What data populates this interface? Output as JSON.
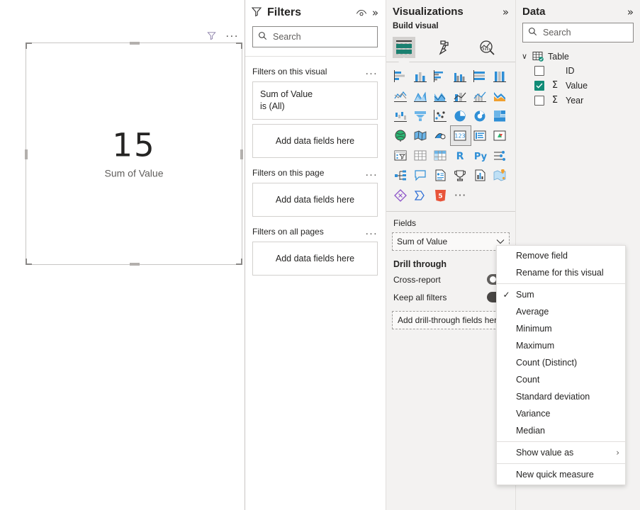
{
  "canvas": {
    "visual_header": {
      "filter_icon": "filter-icon",
      "more_options": "..."
    },
    "card_visual": {
      "value": "15",
      "label": "Sum of Value"
    }
  },
  "filters_pane": {
    "title": "Filters",
    "eye_icon": "eye-icon",
    "collapse_icon": "»",
    "search": {
      "placeholder": "Search",
      "value": "",
      "icon": "search-icon"
    },
    "sections": [
      {
        "title": "Filters on this visual",
        "more": "...",
        "card": {
          "line1": "Sum of Value",
          "line2": "is (All)"
        },
        "dropzone": "Add data fields here"
      },
      {
        "title": "Filters on this page",
        "more": "...",
        "dropzone": "Add data fields here"
      },
      {
        "title": "Filters on all pages",
        "more": "...",
        "dropzone": "Add data fields here"
      }
    ]
  },
  "visualizations_pane": {
    "title": "Visualizations",
    "collapse_icon": "»",
    "build_label": "Build visual",
    "build_tabs": [
      {
        "name": "build-visual-tab",
        "icon": "table-grid-icon",
        "active": true
      },
      {
        "name": "format-visual-tab",
        "icon": "paint-roller-icon",
        "active": false
      },
      {
        "name": "analytics-tab",
        "icon": "magnifier-chart-icon",
        "active": false
      }
    ],
    "viz_icons": [
      "stacked-bar-chart-icon",
      "stacked-column-chart-icon",
      "clustered-bar-chart-icon",
      "clustered-column-chart-icon",
      "100-stacked-bar-chart-icon",
      "100-stacked-column-chart-icon",
      "line-chart-icon",
      "area-chart-icon",
      "stacked-area-chart-icon",
      "line-and-stacked-column-chart-icon",
      "line-and-clustered-column-chart-icon",
      "ribbon-chart-icon",
      "waterfall-chart-icon",
      "funnel-icon",
      "scatter-chart-icon",
      "pie-chart-icon",
      "donut-chart-icon",
      "treemap-icon",
      "map-icon",
      "filled-map-icon",
      "azure-map-icon",
      "card-icon",
      "multi-row-card-icon",
      "kpi-icon",
      "slicer-icon",
      "table-icon",
      "matrix-icon",
      "r-script-visual-icon",
      "python-visual-icon",
      "key-influencers-icon",
      "decomposition-tree-icon",
      "qna-icon",
      "smart-narrative-icon",
      "paginated-report-icon",
      "power-apps-icon",
      "arcgis-maps-icon",
      "powerapps-diamond-icon",
      "power-automate-icon",
      "html5-icon",
      "more-visuals-icon"
    ],
    "selected_viz_index": 21,
    "fields_label": "Fields",
    "field_well": {
      "value": "Sum of Value",
      "chevron": "chevron-down-icon"
    },
    "drill_through": {
      "title": "Drill through",
      "rows": [
        {
          "label": "Cross-report",
          "state": "off"
        },
        {
          "label": "Keep all filters",
          "state": "on"
        }
      ],
      "dropzone": "Add drill-through fields here"
    }
  },
  "data_pane": {
    "title": "Data",
    "collapse_icon": "»",
    "search": {
      "placeholder": "Search",
      "value": "",
      "icon": "search-icon"
    },
    "tree": {
      "table_name": "Table",
      "expanded_chevron": "∨",
      "fields": [
        {
          "label": "ID",
          "checked": false,
          "is_measure": false
        },
        {
          "label": "Value",
          "checked": true,
          "is_measure": true
        },
        {
          "label": "Year",
          "checked": false,
          "is_measure": true
        }
      ]
    }
  },
  "context_menu": {
    "items": [
      {
        "label": "Remove field",
        "checked": false,
        "submenu": false
      },
      {
        "label": "Rename for this visual",
        "checked": false,
        "submenu": false
      },
      {
        "separator": true
      },
      {
        "label": "Sum",
        "checked": true,
        "submenu": false
      },
      {
        "label": "Average",
        "checked": false,
        "submenu": false
      },
      {
        "label": "Minimum",
        "checked": false,
        "submenu": false
      },
      {
        "label": "Maximum",
        "checked": false,
        "submenu": false
      },
      {
        "label": "Count (Distinct)",
        "checked": false,
        "submenu": false
      },
      {
        "label": "Count",
        "checked": false,
        "submenu": false
      },
      {
        "label": "Standard deviation",
        "checked": false,
        "submenu": false
      },
      {
        "label": "Variance",
        "checked": false,
        "submenu": false
      },
      {
        "label": "Median",
        "checked": false,
        "submenu": false
      },
      {
        "separator": true
      },
      {
        "label": "Show value as",
        "checked": false,
        "submenu": true,
        "submenu_icon": "›"
      },
      {
        "separator": true
      },
      {
        "label": "New quick measure",
        "checked": false,
        "submenu": false
      }
    ]
  },
  "colors": {
    "accent_teal": "#118C77",
    "pane_bg": "#f3f2f1",
    "border": "#c8c6c4",
    "text": "#252423",
    "muted_text": "#605e5c",
    "toggle_on_knob": "#f3a712"
  }
}
